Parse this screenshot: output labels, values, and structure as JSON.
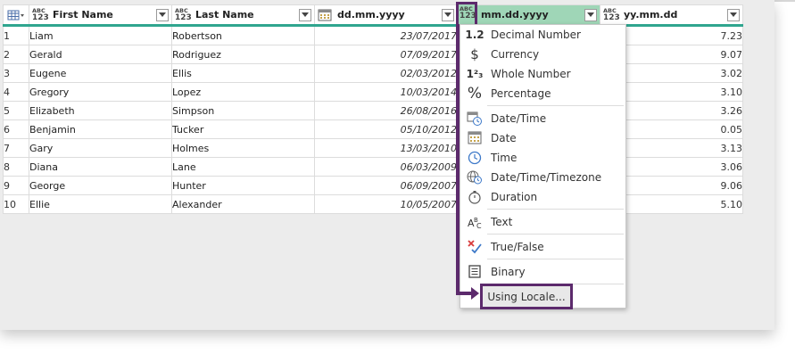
{
  "columns": [
    {
      "type_top": "ABC",
      "type_bottom": "123",
      "title": "First Name"
    },
    {
      "type_top": "ABC",
      "type_bottom": "123",
      "title": "Last Name"
    },
    {
      "type_icon": "calendar-icon",
      "title": "dd.mm.yyyy"
    },
    {
      "type_top": "ABC",
      "type_bottom": "123",
      "title": "mm.dd.yyyy"
    },
    {
      "type_top": "ABC",
      "type_bottom": "123",
      "title": "yy.mm.dd"
    }
  ],
  "rows": [
    {
      "n": "1",
      "first": "Liam",
      "last": "Robertson",
      "date": "23/07/2017",
      "tail": "7.23"
    },
    {
      "n": "2",
      "first": "Gerald",
      "last": "Rodriguez",
      "date": "07/09/2017",
      "tail": "9.07"
    },
    {
      "n": "3",
      "first": "Eugene",
      "last": "Ellis",
      "date": "02/03/2012",
      "tail": "3.02"
    },
    {
      "n": "4",
      "first": "Gregory",
      "last": "Lopez",
      "date": "10/03/2014",
      "tail": "3.10"
    },
    {
      "n": "5",
      "first": "Elizabeth",
      "last": "Simpson",
      "date": "26/08/2016",
      "tail": "3.26"
    },
    {
      "n": "6",
      "first": "Benjamin",
      "last": "Tucker",
      "date": "05/10/2012",
      "tail": "0.05"
    },
    {
      "n": "7",
      "first": "Gary",
      "last": "Holmes",
      "date": "13/03/2010",
      "tail": "3.13"
    },
    {
      "n": "8",
      "first": "Diana",
      "last": "Lane",
      "date": "06/03/2009",
      "tail": "3.06"
    },
    {
      "n": "9",
      "first": "George",
      "last": "Hunter",
      "date": "06/09/2007",
      "tail": "9.06"
    },
    {
      "n": "10",
      "first": "Ellie",
      "last": "Alexander",
      "date": "10/05/2007",
      "tail": "5.10"
    }
  ],
  "menu": {
    "items": [
      {
        "icon": "decimal-number-icon",
        "glyph": "1.2",
        "label": "Decimal Number"
      },
      {
        "icon": "currency-icon",
        "glyph": "$",
        "label": "Currency"
      },
      {
        "icon": "whole-number-icon",
        "glyph": "1²₃",
        "label": "Whole Number"
      },
      {
        "icon": "percentage-icon",
        "glyph": "%",
        "label": "Percentage"
      },
      {
        "icon": "datetime-icon",
        "label": "Date/Time"
      },
      {
        "icon": "date-icon",
        "label": "Date"
      },
      {
        "icon": "time-icon",
        "label": "Time"
      },
      {
        "icon": "datetime-timezone-icon",
        "label": "Date/Time/Timezone"
      },
      {
        "icon": "duration-icon",
        "label": "Duration"
      },
      {
        "icon": "text-icon",
        "label": "Text"
      },
      {
        "icon": "true-false-icon",
        "label": "True/False"
      },
      {
        "icon": "binary-icon",
        "label": "Binary"
      }
    ],
    "using_locale": "Using Locale..."
  },
  "colors": {
    "header_underline": "#2fa58f",
    "active_header": "#9fd6b7",
    "highlight": "#5c2a6c"
  }
}
